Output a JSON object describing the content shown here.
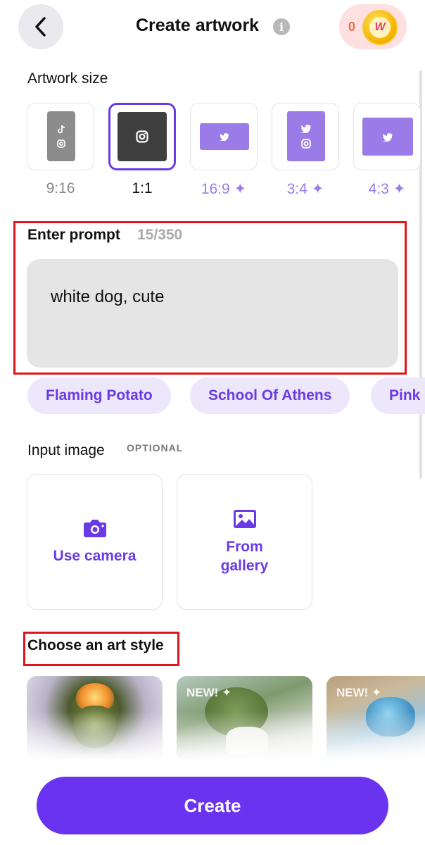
{
  "header": {
    "title": "Create artwork",
    "info_icon": "i",
    "coin_count": "0",
    "coin_logo": "W"
  },
  "artwork_size": {
    "label": "Artwork size",
    "options": [
      {
        "label": "9:16",
        "icons": [
          "tiktok-icon",
          "instagram-icon"
        ],
        "premium": false,
        "selected": false
      },
      {
        "label": "1:1",
        "icons": [
          "instagram-icon"
        ],
        "premium": false,
        "selected": true
      },
      {
        "label": "16:9",
        "icons": [
          "twitter-icon"
        ],
        "premium": true,
        "selected": false
      },
      {
        "label": "3:4",
        "icons": [
          "twitter-icon",
          "instagram-icon"
        ],
        "premium": true,
        "selected": false
      },
      {
        "label": "4:3",
        "icons": [
          "twitter-icon"
        ],
        "premium": true,
        "selected": false
      }
    ],
    "premium_mark": "✦"
  },
  "prompt": {
    "label": "Enter prompt",
    "counter": "15/350",
    "value": "white dog, cute"
  },
  "suggestions": [
    "Flaming Potato",
    "School Of Athens",
    "Pink"
  ],
  "input_image": {
    "label": "Input image",
    "optional": "OPTIONAL",
    "camera_label": "Use camera",
    "gallery_label": "From gallery"
  },
  "art_style": {
    "label": "Choose an art style",
    "new_badge": "NEW! ✦"
  },
  "create_label": "Create",
  "colors": {
    "accent": "#6a33ef",
    "chip_bg": "#ede7fb",
    "highlight": "#e0141a",
    "premium_text": "#9a7be8"
  }
}
